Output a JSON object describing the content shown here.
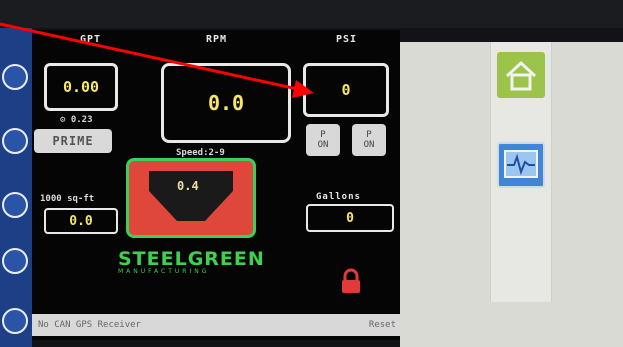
{
  "screen": {
    "gpt": {
      "label": "GPT",
      "value": "0.00",
      "sub": "0.23"
    },
    "rpm": {
      "label": "RPM",
      "value": "0.0",
      "sub": "Speed:2-9"
    },
    "psi": {
      "label": "PSI",
      "value": "0"
    },
    "p_buttons": [
      {
        "label": "P",
        "sub": "ON"
      },
      {
        "label": "P",
        "sub": "ON"
      }
    ],
    "prime_label": "PRIME",
    "area": {
      "label": "1000 sq-ft",
      "value": "0.0"
    },
    "pump_value": "0.4",
    "gallons": {
      "label": "Gallons",
      "value": "0"
    },
    "logo": {
      "main": "STEELGREEN",
      "sub": "MANUFACTURING"
    },
    "status": {
      "left": "No CAN GPS Receiver",
      "right": "Reset"
    }
  },
  "icons": {
    "left_strip": [
      "settings-icon",
      "sync-icon",
      "heart-icon",
      "hex-icon",
      "power-icon"
    ],
    "right_panel": [
      "home-icon",
      "pulse-icon"
    ],
    "lock": "lock-icon"
  },
  "colors": {
    "value_yellow": "#f6e76a",
    "brand_green": "#3ed14f",
    "pump_red": "#e0473b",
    "annotation_red": "#ff0000",
    "panel_grey": "#dadad5"
  }
}
